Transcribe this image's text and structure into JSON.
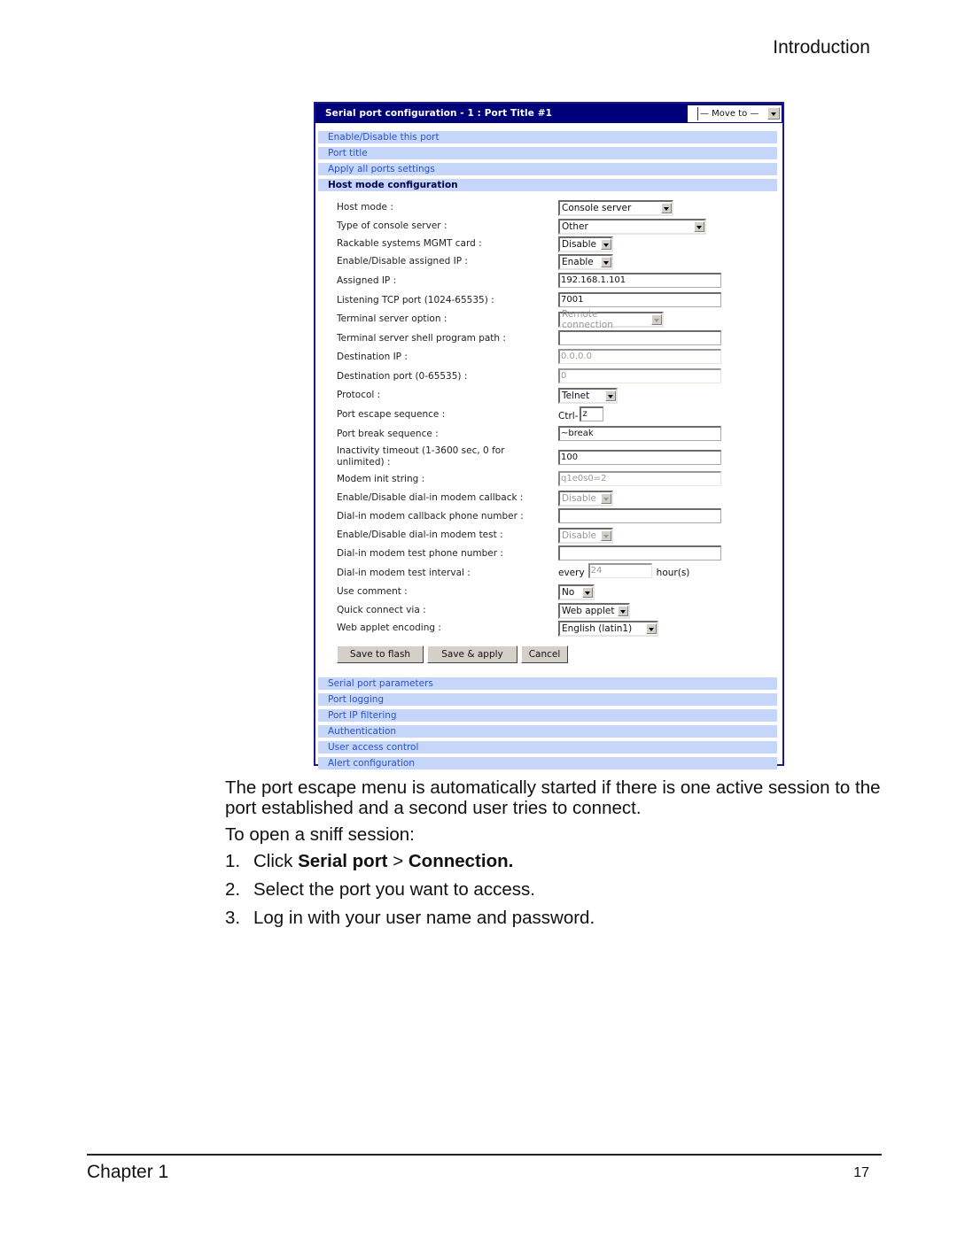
{
  "running_head": "Introduction",
  "panel": {
    "title": "Serial port configuration - 1 : Port Title #1",
    "move_to": "— Move to —",
    "top_nav": [
      {
        "label": "Enable/Disable this port",
        "active": false
      },
      {
        "label": "Port title",
        "active": false
      },
      {
        "label": "Apply all ports settings",
        "active": false
      },
      {
        "label": "Host mode configuration",
        "active": true
      }
    ],
    "fields": {
      "host_mode": {
        "label": "Host mode :",
        "value": "Console server"
      },
      "console_type": {
        "label": "Type of console server :",
        "value": "Other"
      },
      "mgmt_card": {
        "label": "Rackable systems MGMT card :",
        "value": "Disable"
      },
      "assigned_ip_toggle": {
        "label": "Enable/Disable assigned IP :",
        "value": "Enable"
      },
      "assigned_ip": {
        "label": "Assigned IP :",
        "value": "192.168.1.101"
      },
      "tcp_port": {
        "label": "Listening TCP port (1024-65535) :",
        "value": "7001"
      },
      "ts_option": {
        "label": "Terminal server option :",
        "value": "Remote connection"
      },
      "shell_path": {
        "label": "Terminal server shell program path :",
        "value": ""
      },
      "dest_ip": {
        "label": "Destination IP :",
        "value": "0.0.0.0"
      },
      "dest_port": {
        "label": "Destination port (0-65535) :",
        "value": "0"
      },
      "protocol": {
        "label": "Protocol :",
        "value": "Telnet"
      },
      "escape_seq": {
        "label": "Port escape sequence :",
        "prefix": "Ctrl-",
        "value": "z"
      },
      "break_seq": {
        "label": "Port break sequence :",
        "value": "~break"
      },
      "inactivity": {
        "label": "Inactivity timeout (1-3600 sec, 0 for unlimited) :",
        "value": "100"
      },
      "modem_init": {
        "label": "Modem init string :",
        "value": "q1e0s0=2"
      },
      "callback_toggle": {
        "label": "Enable/Disable dial-in modem callback :",
        "value": "Disable"
      },
      "callback_phone": {
        "label": "Dial-in modem callback phone number :",
        "value": ""
      },
      "modem_test_toggle": {
        "label": "Enable/Disable dial-in modem test :",
        "value": "Disable"
      },
      "test_phone": {
        "label": "Dial-in modem test phone number :",
        "value": ""
      },
      "test_interval": {
        "label": "Dial-in modem test interval :",
        "prefix": "every",
        "value": "24",
        "suffix": "hour(s)"
      },
      "use_comment": {
        "label": "Use comment :",
        "value": "No"
      },
      "quick_connect": {
        "label": "Quick connect via :",
        "value": "Web applet"
      },
      "applet_encoding": {
        "label": "Web applet encoding :",
        "value": "English (latin1)"
      }
    },
    "buttons": {
      "save_flash": "Save to flash",
      "save_apply": "Save & apply",
      "cancel": "Cancel"
    },
    "bottom_nav": [
      {
        "label": "Serial port parameters"
      },
      {
        "label": "Port logging"
      },
      {
        "label": "Port IP filtering"
      },
      {
        "label": "Authentication"
      },
      {
        "label": "User access control"
      },
      {
        "label": "Alert configuration"
      }
    ]
  },
  "body": {
    "para1": "The port escape menu is automatically started if there is one active session to the port established and a second user tries to connect.",
    "para2": "To open a sniff session:",
    "steps": [
      {
        "num": "1.",
        "pre": "Click ",
        "b1": "Serial port",
        "mid": " > ",
        "b2": "Connection."
      },
      {
        "num": "2.",
        "text": "Select the port you want to access."
      },
      {
        "num": "3.",
        "text": "Log in with your user name and password."
      }
    ]
  },
  "footer": {
    "chapter": "Chapter 1",
    "page": "17"
  }
}
